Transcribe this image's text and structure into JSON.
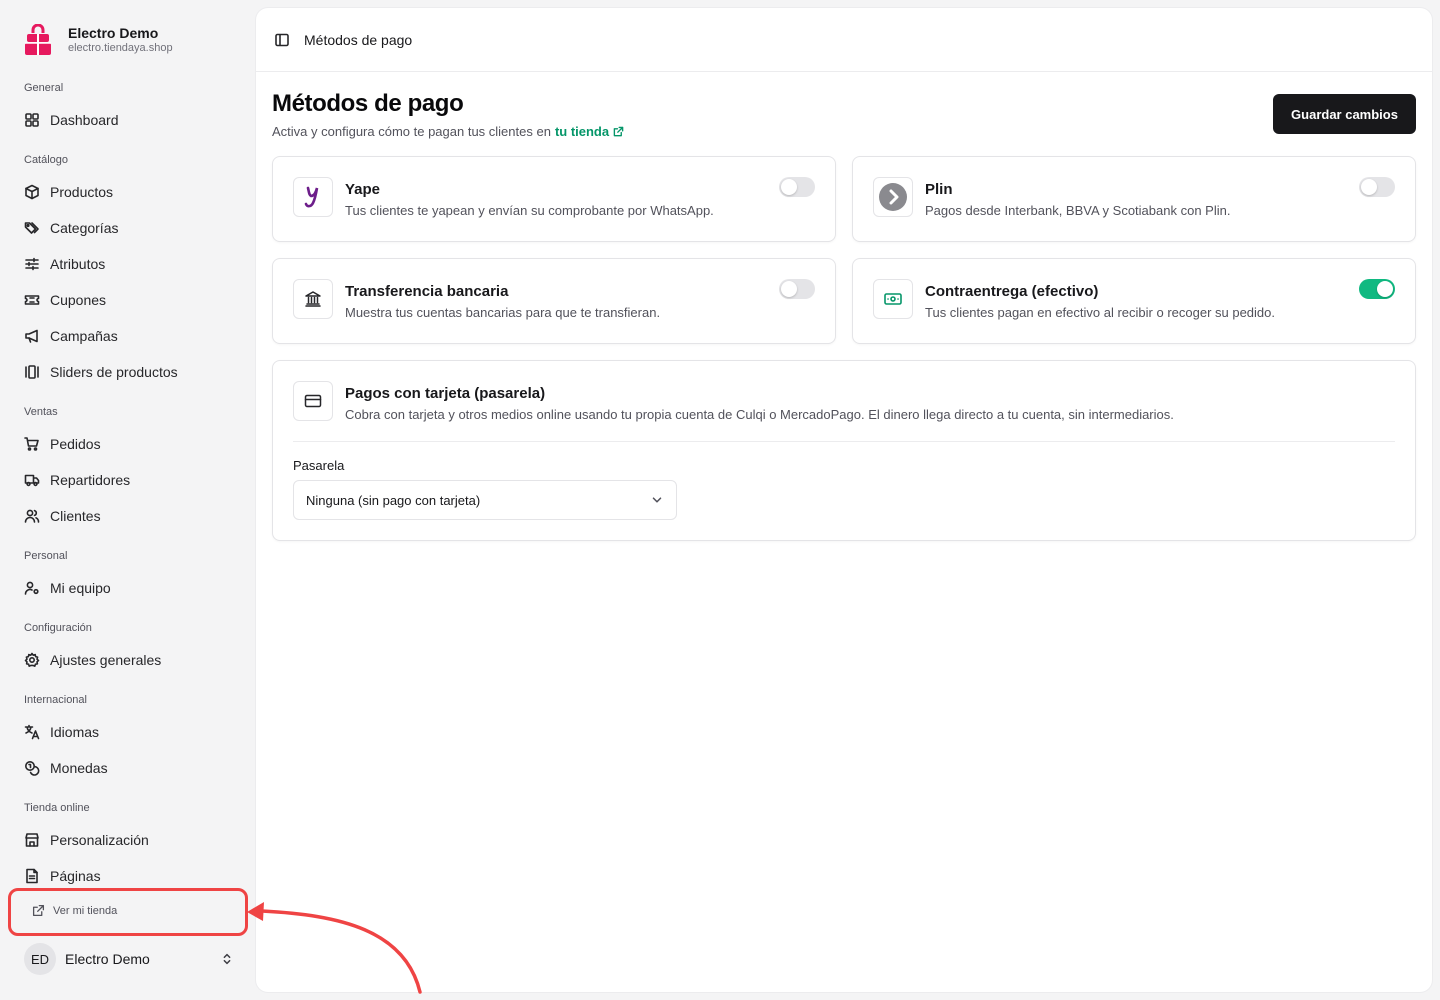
{
  "store": {
    "name": "Electro Demo",
    "url": "electro.tiendaya.shop"
  },
  "sidebar": {
    "groups": [
      {
        "label": "General"
      },
      {
        "label": "Catálogo"
      },
      {
        "label": "Ventas"
      },
      {
        "label": "Personal"
      },
      {
        "label": "Configuración"
      },
      {
        "label": "Internacional"
      },
      {
        "label": "Tienda online"
      }
    ],
    "items": [
      {
        "label": "Dashboard",
        "icon": "dashboard-icon"
      },
      {
        "label": "Productos",
        "icon": "box-icon"
      },
      {
        "label": "Categorías",
        "icon": "tags-icon"
      },
      {
        "label": "Atributos",
        "icon": "sliders-icon"
      },
      {
        "label": "Cupones",
        "icon": "ticket-icon"
      },
      {
        "label": "Campañas",
        "icon": "megaphone-icon"
      },
      {
        "label": "Sliders de productos",
        "icon": "gallery-icon"
      },
      {
        "label": "Pedidos",
        "icon": "cart-icon"
      },
      {
        "label": "Repartidores",
        "icon": "truck-icon"
      },
      {
        "label": "Clientes",
        "icon": "users-icon"
      },
      {
        "label": "Mi equipo",
        "icon": "user-cog-icon"
      },
      {
        "label": "Ajustes generales",
        "icon": "gear-icon"
      },
      {
        "label": "Idiomas",
        "icon": "languages-icon"
      },
      {
        "label": "Monedas",
        "icon": "coins-icon"
      },
      {
        "label": "Personalización",
        "icon": "store-icon"
      },
      {
        "label": "Páginas",
        "icon": "file-icon"
      }
    ],
    "view_store": "Ver mi tienda",
    "user": {
      "initials": "ED",
      "name": "Electro Demo"
    }
  },
  "topbar": {
    "title": "Métodos de pago"
  },
  "page": {
    "title": "Métodos de pago",
    "subtitle": "Activa y configura cómo te pagan tus clientes en",
    "subtitle_link": "tu tienda",
    "save_label": "Guardar cambios"
  },
  "methods": [
    {
      "title": "Yape",
      "desc": "Tus clientes te yapean y envían su comprobante por WhatsApp.",
      "enabled": false
    },
    {
      "title": "Plin",
      "desc": "Pagos desde Interbank, BBVA y Scotiabank con Plin.",
      "enabled": false
    },
    {
      "title": "Transferencia bancaria",
      "desc": "Muestra tus cuentas bancarias para que te transfieran.",
      "enabled": false
    },
    {
      "title": "Contraentrega (efectivo)",
      "desc": "Tus clientes pagan en efectivo al recibir o recoger su pedido.",
      "enabled": true
    }
  ],
  "gateway": {
    "title": "Pagos con tarjeta (pasarela)",
    "desc": "Cobra con tarjeta y otros medios online usando tu propia cuenta de Culqi o MercadoPago. El dinero llega directo a tu cuenta, sin intermediarios.",
    "label": "Pasarela",
    "selected": "Ninguna (sin pago con tarjeta)"
  },
  "colors": {
    "accent": "#10b981",
    "link": "#059669",
    "highlight": "#ef4444",
    "brand": "#e6195e",
    "yape": "#6d1e8a"
  }
}
